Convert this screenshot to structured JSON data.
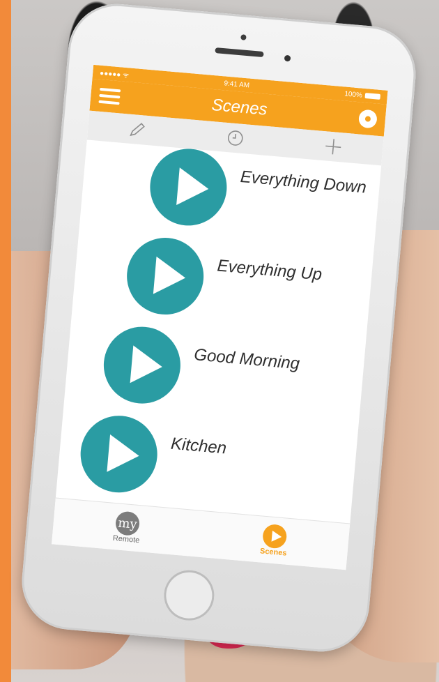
{
  "status": {
    "time": "9:41 AM",
    "battery": "100%"
  },
  "nav": {
    "title": "Scenes"
  },
  "scenes": [
    {
      "label": "Everything Down"
    },
    {
      "label": "Everything Up"
    },
    {
      "label": "Good Morning"
    },
    {
      "label": "Kitchen"
    }
  ],
  "tabs": [
    {
      "label": "Remote",
      "badge": "my"
    },
    {
      "label": "Scenes"
    }
  ],
  "colors": {
    "accent": "#f6a21e",
    "play_button": "#2a9ca3",
    "side_strip": "#f28a3a"
  },
  "icons": [
    "menu-icon",
    "disc-icon",
    "pencil-icon",
    "clock-icon",
    "plus-icon",
    "play-icon"
  ]
}
